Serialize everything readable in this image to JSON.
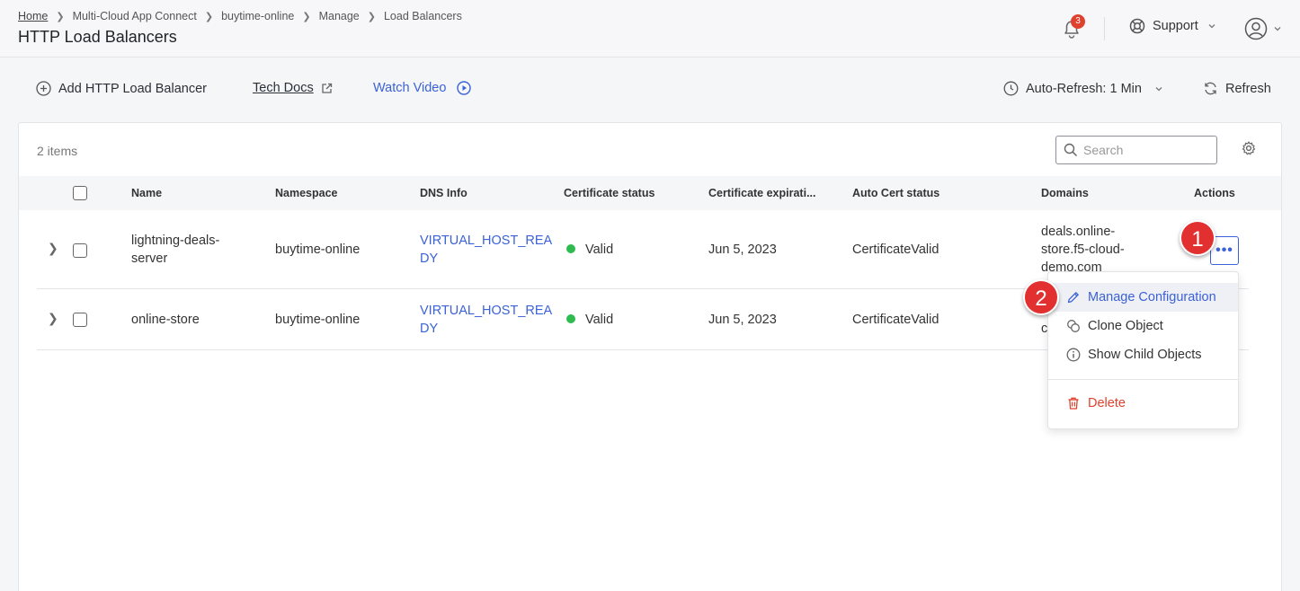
{
  "breadcrumb": [
    "Home",
    "Multi-Cloud App Connect",
    "buytime-online",
    "Manage",
    "Load Balancers"
  ],
  "page_title": "HTTP Load Balancers",
  "header": {
    "notification_count": "3",
    "support_label": "Support"
  },
  "toolbar": {
    "add_label": "Add HTTP Load Balancer",
    "tech_docs_label": "Tech Docs",
    "watch_video_label": "Watch Video",
    "auto_refresh_label": "Auto-Refresh: 1 Min",
    "refresh_label": "Refresh"
  },
  "table": {
    "items_count": "2 items",
    "search_placeholder": "Search",
    "columns": [
      "Name",
      "Namespace",
      "DNS Info",
      "Certificate status",
      "Certificate expirati...",
      "Auto Cert status",
      "Domains",
      "Actions"
    ],
    "rows": [
      {
        "name": [
          "lightning-deals-",
          "server"
        ],
        "namespace": "buytime-online",
        "dns_info": [
          "VIRTUAL_HOST_REA",
          "DY"
        ],
        "cert_status": "Valid",
        "cert_expiration": "Jun 5, 2023",
        "auto_cert_status": "CertificateValid",
        "domains": [
          "deals.online-",
          "store.f5-cloud-",
          "demo.com"
        ]
      },
      {
        "name": [
          "online-store"
        ],
        "namespace": "buytime-online",
        "dns_info": [
          "VIRTUAL_HOST_REA",
          "DY"
        ],
        "cert_status": "Valid",
        "cert_expiration": "Jun 5, 2023",
        "auto_cert_status": "CertificateValid",
        "domains": [
          "c"
        ]
      }
    ],
    "actions_label": "•••"
  },
  "menu": {
    "manage": "Manage Configuration",
    "clone": "Clone Object",
    "show_child": "Show Child Objects",
    "delete": "Delete"
  },
  "markers": [
    "1",
    "2"
  ],
  "colors": {
    "accent": "#3b62d6",
    "danger": "#e0402e",
    "valid": "#2fbb4f",
    "marker": "#e22f2f"
  }
}
